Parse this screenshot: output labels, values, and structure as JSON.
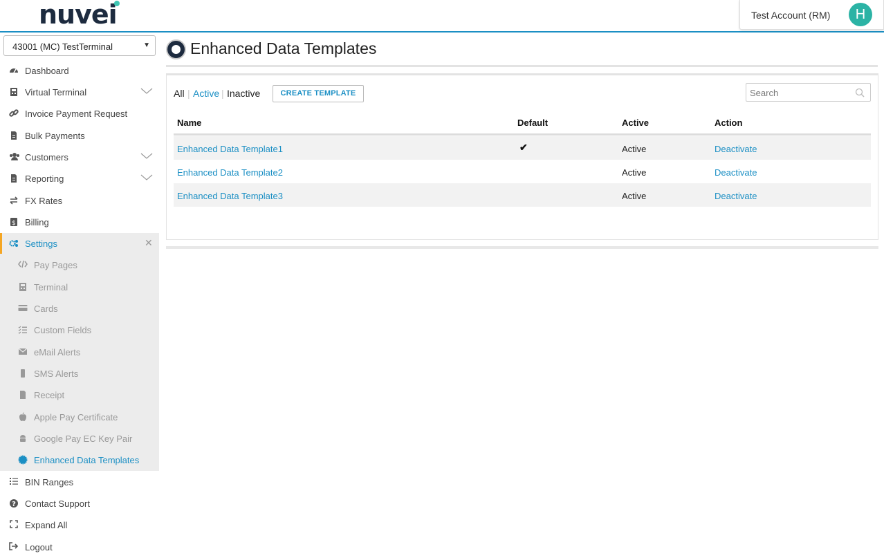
{
  "header": {
    "logo": "nuvei",
    "account_name": "Test Account (RM)",
    "avatar_letter": "H"
  },
  "sidebar": {
    "terminal": "43001 (MC) TestTerminal",
    "items": [
      {
        "label": "Dashboard",
        "icon": "dashboard-icon"
      },
      {
        "label": "Virtual Terminal",
        "icon": "calculator-icon"
      },
      {
        "label": "Invoice Payment Request",
        "icon": "link-icon"
      },
      {
        "label": "Bulk Payments",
        "icon": "file-icon"
      },
      {
        "label": "Customers",
        "icon": "users-icon"
      },
      {
        "label": "Reporting",
        "icon": "report-icon"
      },
      {
        "label": "FX Rates",
        "icon": "exchange-icon"
      },
      {
        "label": "Billing",
        "icon": "dollar-icon"
      },
      {
        "label": "Settings",
        "icon": "gears-icon"
      }
    ],
    "settings_sub": [
      {
        "label": "Pay Pages",
        "icon": "code-icon"
      },
      {
        "label": "Terminal",
        "icon": "calculator-icon"
      },
      {
        "label": "Cards",
        "icon": "card-icon"
      },
      {
        "label": "Custom Fields",
        "icon": "checklist-icon"
      },
      {
        "label": "eMail Alerts",
        "icon": "envelope-icon"
      },
      {
        "label": "SMS Alerts",
        "icon": "phone-icon"
      },
      {
        "label": "Receipt",
        "icon": "document-icon"
      },
      {
        "label": "Apple Pay Certificate",
        "icon": "apple-icon"
      },
      {
        "label": "Google Pay EC Key Pair",
        "icon": "android-icon"
      },
      {
        "label": "Enhanced Data Templates",
        "icon": "badge-icon"
      }
    ],
    "bottom_items": [
      {
        "label": "BIN Ranges",
        "icon": "list-icon"
      },
      {
        "label": "Contact Support",
        "icon": "question-icon"
      },
      {
        "label": "Expand All",
        "icon": "expand-icon"
      },
      {
        "label": "Logout",
        "icon": "logout-icon"
      }
    ]
  },
  "main": {
    "title": "Enhanced Data Templates",
    "filters": {
      "all": "All",
      "active": "Active",
      "inactive": "Inactive",
      "sep": "|"
    },
    "create_button": "CREATE TEMPLATE",
    "search_placeholder": "Search",
    "columns": [
      "Name",
      "Default",
      "Active",
      "Action"
    ],
    "rows": [
      {
        "name": "Enhanced Data Template1",
        "default": "✔",
        "active": "Active",
        "action": "Deactivate"
      },
      {
        "name": "Enhanced Data Template2",
        "default": "",
        "active": "Active",
        "action": "Deactivate"
      },
      {
        "name": "Enhanced Data Template3",
        "default": "",
        "active": "Active",
        "action": "Deactivate"
      }
    ]
  },
  "colors": {
    "accent": "#1b8fc4",
    "brand_teal": "#2bb3a5",
    "active_marker": "#f5a623",
    "logo_navy": "#1d2b3f"
  }
}
